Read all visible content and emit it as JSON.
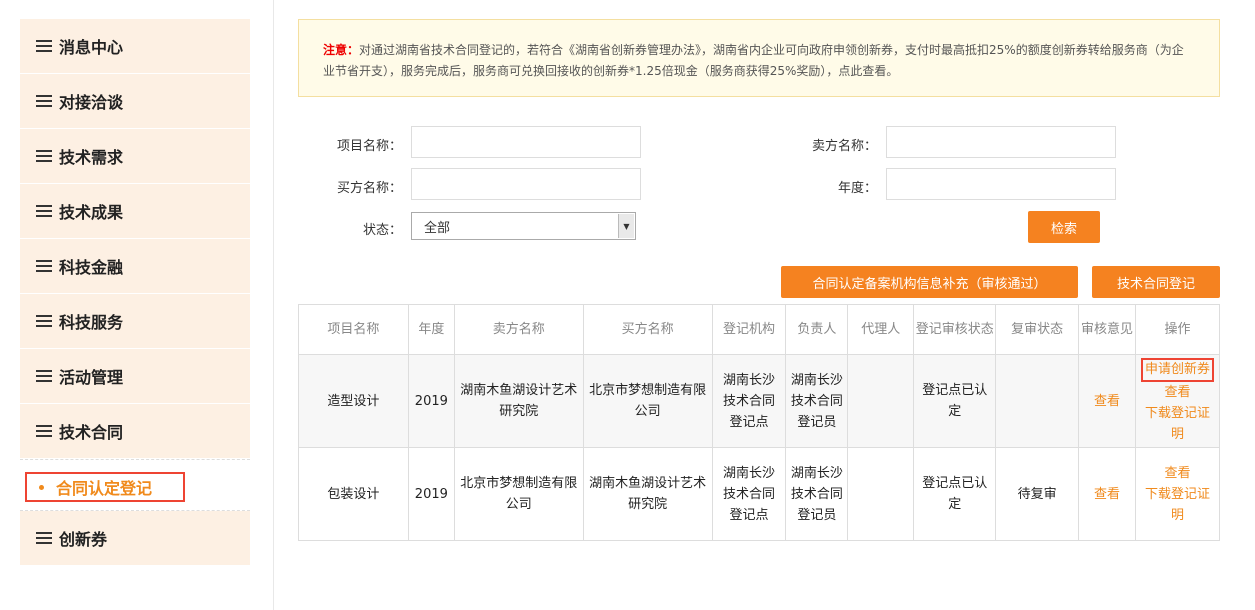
{
  "sidebar": {
    "items": [
      {
        "label": "消息中心"
      },
      {
        "label": "对接洽谈"
      },
      {
        "label": "技术需求"
      },
      {
        "label": "技术成果"
      },
      {
        "label": "科技金融"
      },
      {
        "label": "科技服务"
      },
      {
        "label": "活动管理"
      },
      {
        "label": "技术合同"
      }
    ],
    "active_sub": "合同认定登记",
    "last": "创新券"
  },
  "notice": {
    "prefix": "注意：",
    "text": "对通过湖南省技术合同登记的，若符合《湖南省创新券管理办法》，湖南省内企业可向政府申领创新券，支付时最高抵扣25%的额度创新券转给服务商（为企业节省开支），服务完成后，服务商可兑换回接收的创新券*1.25倍现金（服务商获得25%奖励），点此查看。"
  },
  "form": {
    "project_label": "项目名称：",
    "seller_label": "卖方名称：",
    "buyer_label": "买方名称：",
    "year_label": "年度：",
    "status_label": "状态：",
    "status_value": "全部",
    "search_btn": "检索"
  },
  "actions": {
    "supplement_btn": "合同认定备案机构信息补充（审核通过）",
    "register_btn": "技术合同登记"
  },
  "table": {
    "headers": [
      "项目名称",
      "年度",
      "卖方名称",
      "买方名称",
      "登记机构",
      "负责人",
      "代理人",
      "登记审核状态",
      "复审状态",
      "审核意见",
      "操作"
    ],
    "rows": [
      {
        "project": "造型设计",
        "year": "2019",
        "seller": "湖南木鱼湖设计艺术研究院",
        "buyer": "北京市梦想制造有限公司",
        "org": "湖南长沙技术合同登记点",
        "person": "湖南长沙技术合同登记员",
        "agent": "",
        "status": "登记点已认定",
        "review": "",
        "opinion": "查看",
        "op_apply": "申请创新券",
        "op_view": "查看",
        "op_download": "下载登记证明"
      },
      {
        "project": "包装设计",
        "year": "2019",
        "seller": "北京市梦想制造有限公司",
        "buyer": "湖南木鱼湖设计艺术研究院",
        "org": "湖南长沙技术合同登记点",
        "person": "湖南长沙技术合同登记员",
        "agent": "",
        "status": "登记点已认定",
        "review": "待复审",
        "opinion": "查看",
        "op_view": "查看",
        "op_download": "下载登记证明"
      }
    ]
  }
}
